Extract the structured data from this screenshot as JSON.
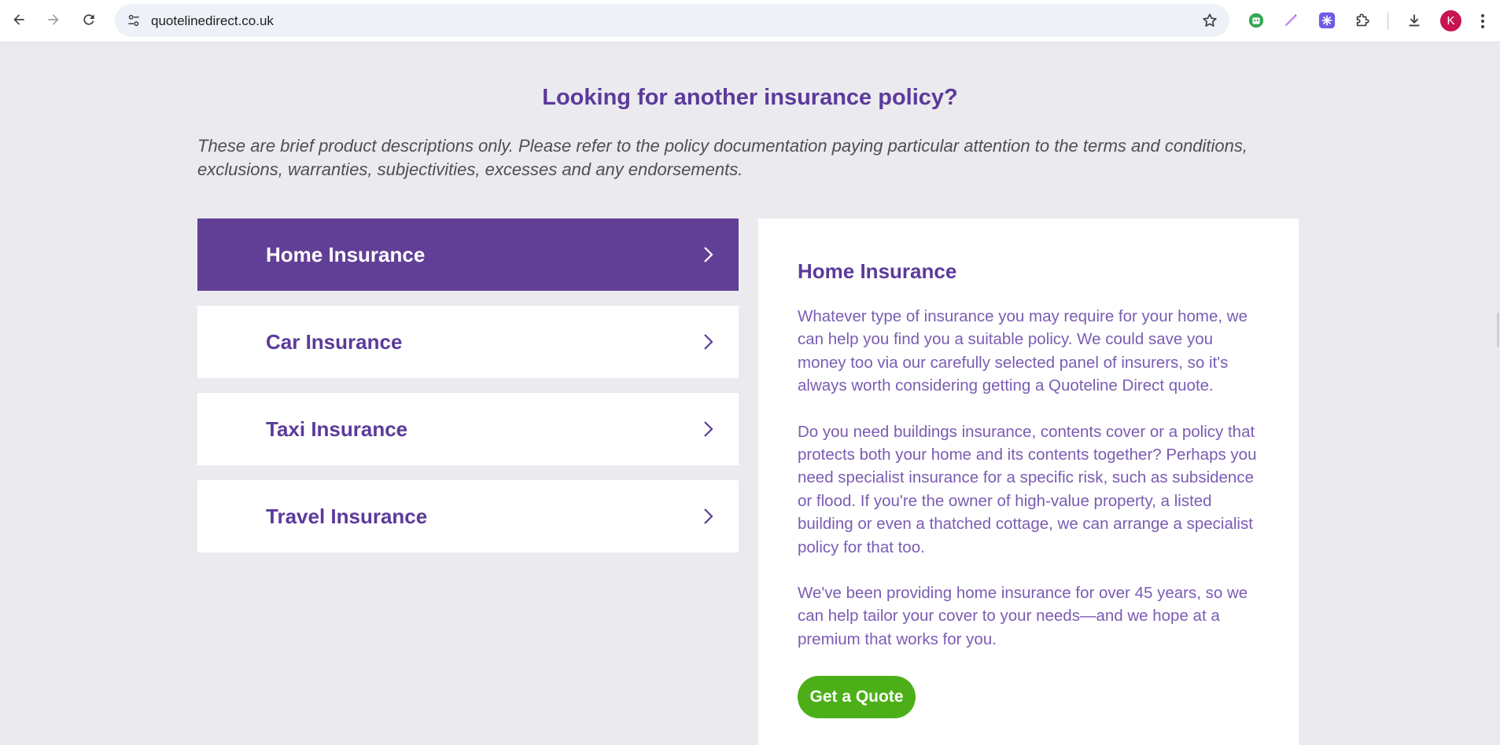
{
  "browser": {
    "url": "quotelinedirect.co.uk",
    "avatar_letter": "K",
    "icons": {
      "back": "arrow-left-icon",
      "forward": "arrow-right-icon",
      "reload": "reload-icon",
      "site_info": "tune-icon",
      "bookmark": "star-icon",
      "extensions": [
        "robot-extension-icon",
        "pen-extension-icon",
        "snowflake-extension-icon",
        "puzzle-icon"
      ],
      "download": "download-icon",
      "menu": "more-vert-icon"
    }
  },
  "page": {
    "heading": "Looking for another insurance policy?",
    "disclaimer": "These are brief product descriptions only. Please refer to the policy documentation paying particular attention to the terms and conditions, exclusions, warranties, subjectivities, excesses and any endorsements.",
    "tabs": [
      {
        "label": "Home Insurance",
        "active": true
      },
      {
        "label": "Car Insurance",
        "active": false
      },
      {
        "label": "Taxi Insurance",
        "active": false
      },
      {
        "label": "Travel Insurance",
        "active": false
      }
    ],
    "panel": {
      "title": "Home Insurance",
      "paragraphs": [
        "Whatever type of insurance you may require for your home, we can help you find you a suitable policy. We could save you money too via our carefully selected panel of insurers, so it's always worth considering getting a Quoteline Direct quote.",
        "Do you need buildings insurance, contents cover or a policy that protects both your home and its contents together? Perhaps you need specialist insurance for a specific risk, such as subsidence or flood. If you're the owner of high-value property, a listed building or even a thatched cottage, we can arrange a specialist policy for that too.",
        "We've been providing home insurance for over 45 years, so we can help tailor your cover to your needs—and we hope at a premium that works for you."
      ],
      "cta_label": "Get a Quote"
    }
  },
  "colors": {
    "brand_purple": "#623f96",
    "text_purple": "#5b3a9b",
    "body_purple": "#7a5cb3",
    "cta_green": "#4caf17",
    "page_bg": "#ebeaef",
    "avatar_red": "#c8144f"
  }
}
